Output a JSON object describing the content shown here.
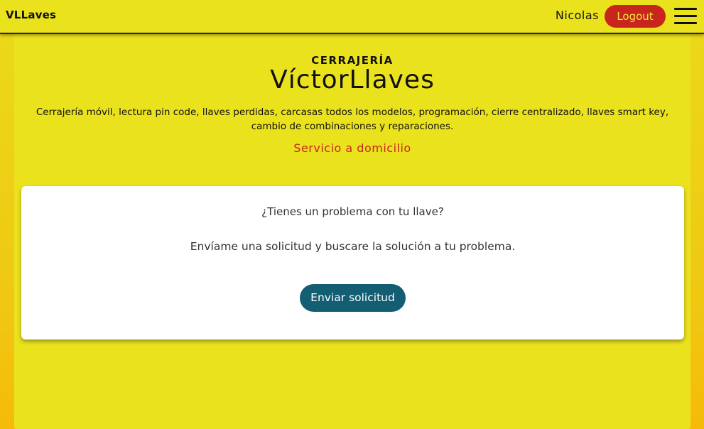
{
  "navbar": {
    "brand": "VLLaves",
    "username": "Nicolas",
    "logout_label": "Logout",
    "menu_icon": "hamburger-menu-icon"
  },
  "hero": {
    "eyebrow": "CERRAJERÍA",
    "title": "VíctorLlaves",
    "description": "Cerrajería móvil, lectura pin code, llaves perdidas, carcasas todos los modelos, programación, cierre centralizado, llaves smart key, cambio de combinaciones y reparaciones.",
    "service": "Servicio a domicilio"
  },
  "card": {
    "question": "¿Tienes un problema con tu llave?",
    "text": "Envíame una solicitud y buscare la solución a tu problema.",
    "button_label": "Enviar solicitud"
  },
  "colors": {
    "background": "#ebe21e",
    "logout_button": "#c8261c",
    "logout_text": "#f2e43a",
    "service_text": "#c8261c",
    "send_button": "#135e73",
    "card": "#ffffff"
  }
}
